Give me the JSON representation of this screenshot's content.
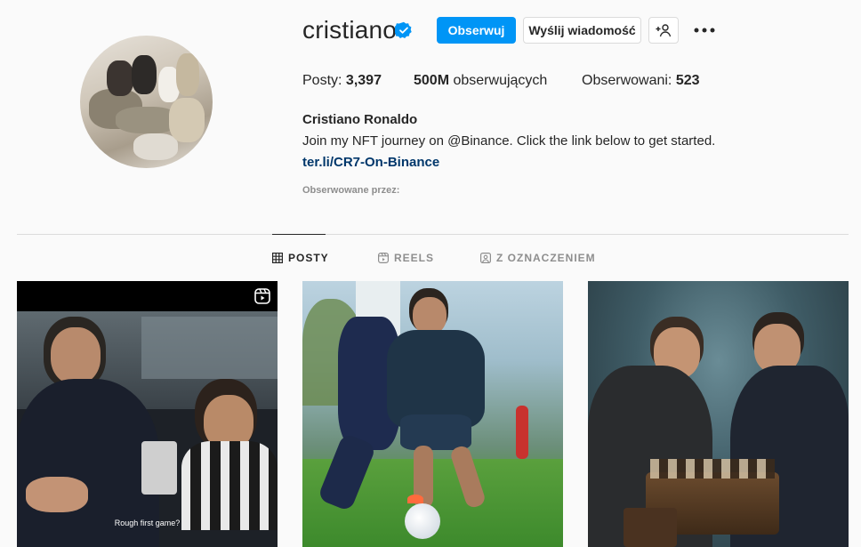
{
  "profile": {
    "username": "cristiano",
    "full_name": "Cristiano Ronaldo",
    "bio": "Join my NFT journey on @Binance. Click the link below to get started.",
    "link": "ter.li/CR7-On-Binance",
    "followed_by": "Obserwowane przez:"
  },
  "actions": {
    "follow_label": "Obserwuj",
    "message_label": "Wyślij wiadomość",
    "add_icon": "add-person-icon",
    "more_icon": "more-icon"
  },
  "stats": {
    "posts_label": "Posty:",
    "posts_value": "3,397",
    "followers_value": "500M",
    "followers_label": "obserwujących",
    "following_label": "Obserwowani:",
    "following_value": "523"
  },
  "tabs": [
    {
      "label": "POSTY",
      "icon": "grid-icon",
      "active": true
    },
    {
      "label": "REELS",
      "icon": "reels-icon",
      "active": false
    },
    {
      "label": "Z OZNACZENIEM",
      "icon": "tagged-icon",
      "active": false
    }
  ],
  "posts": [
    {
      "caption": "Rough first game?",
      "type": "reel"
    },
    {
      "caption": "",
      "type": "photo"
    },
    {
      "caption": "",
      "type": "photo"
    }
  ],
  "colors": {
    "accent": "#0095f6",
    "link": "#00376b",
    "muted": "#8e8e8e",
    "text": "#262626",
    "background": "#fafafa"
  }
}
